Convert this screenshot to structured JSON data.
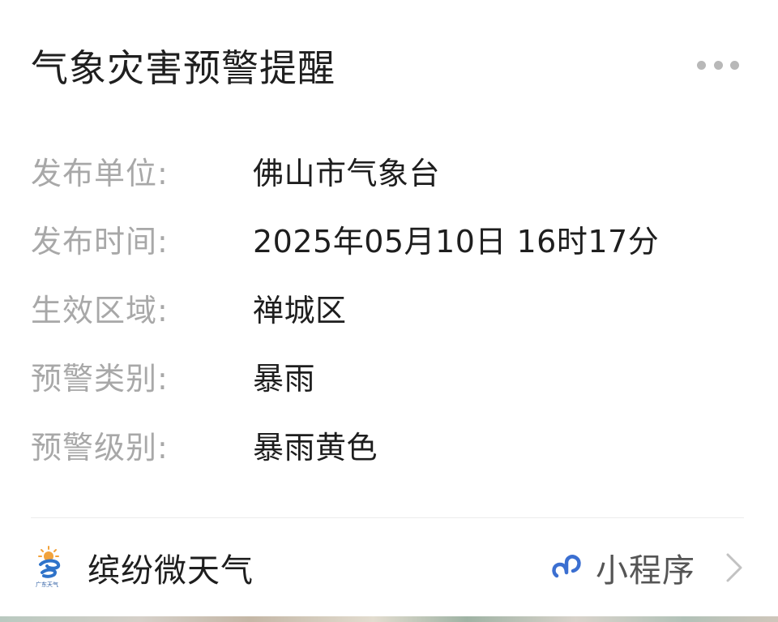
{
  "card": {
    "title": "气象灾害预警提醒",
    "more_icon": "more-dots-icon"
  },
  "fields": [
    {
      "label": "发布单位:",
      "value": "佛山市气象台"
    },
    {
      "label": "发布时间:",
      "value": "2025年05月10日 16时17分"
    },
    {
      "label": "生效区域:",
      "value": "禅城区"
    },
    {
      "label": "预警类别:",
      "value": "暴雨"
    },
    {
      "label": "预警级别:",
      "value": "暴雨黄色"
    }
  ],
  "footer": {
    "app_logo_icon": "weather-app-logo-icon",
    "app_logo_caption": "广东天气",
    "app_name": "缤纷微天气",
    "mini_program_icon": "mini-program-link-icon",
    "mini_program_label": "小程序",
    "chevron_icon": "chevron-right-icon"
  },
  "colors": {
    "label": "#a8a8a8",
    "value": "#1e1e1e",
    "accent": "#3b6fd1",
    "divider": "#ececec"
  }
}
